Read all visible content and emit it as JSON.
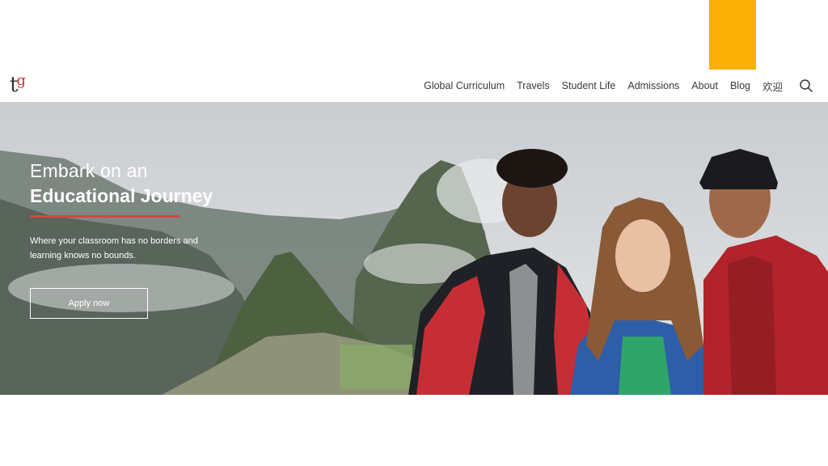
{
  "colors": {
    "accent": "#FAB005",
    "underline": "#D64545"
  },
  "header": {
    "logo": "tg",
    "nav": [
      "Global Curriculum",
      "Travels",
      "Student Life",
      "Admissions",
      "About",
      "Blog",
      "欢迎"
    ],
    "search_icon": "search-icon"
  },
  "hero": {
    "line1": "Embark on an",
    "line2": "Educational Journey",
    "subtitle": "Where your classroom has no borders and learning knows no bounds.",
    "cta": "Apply now"
  }
}
